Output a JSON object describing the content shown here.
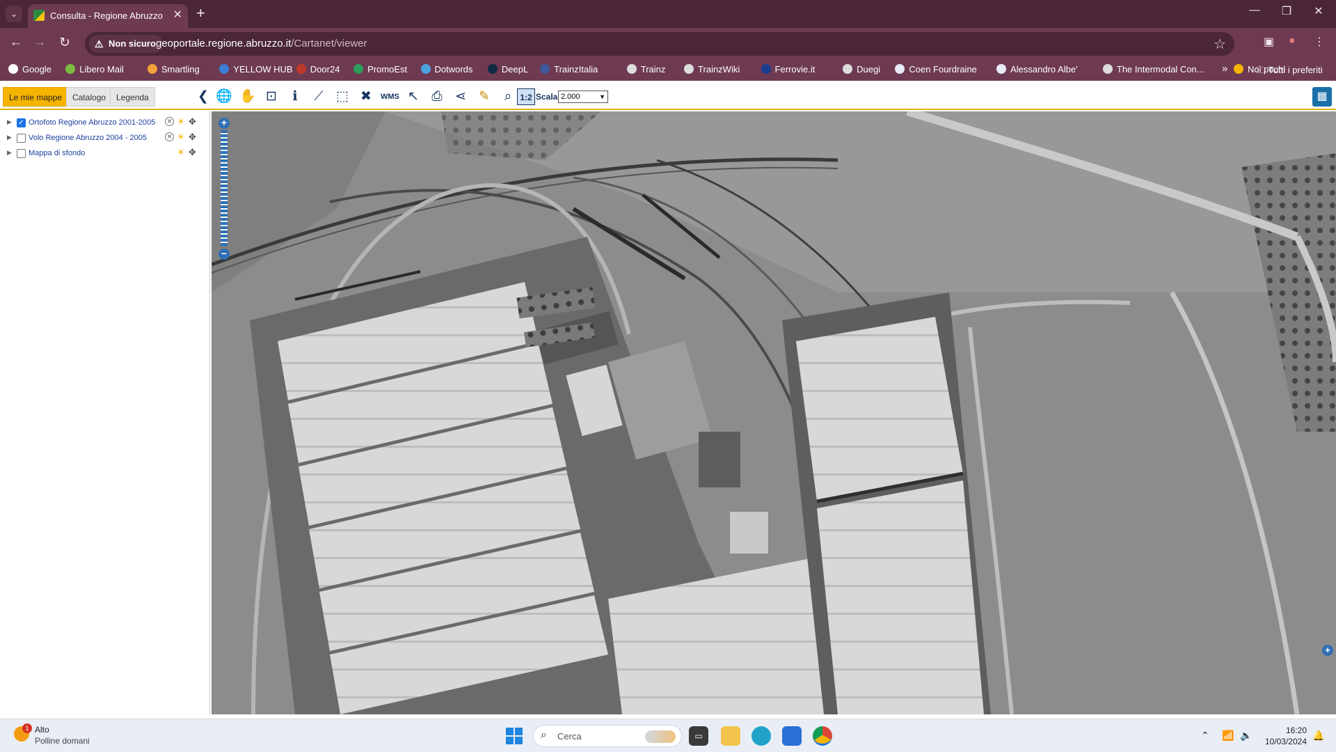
{
  "browser": {
    "tab_title": "Consulta - Regione Abruzzo",
    "not_secure_label": "Non sicuro",
    "url_host": "geoportale.regione.abruzzo.it",
    "url_path": "/Cartanet/viewer",
    "bookmarks": [
      {
        "label": "Google",
        "color": "#ffffff"
      },
      {
        "label": "Libero Mail",
        "color": "#7dbb42"
      },
      {
        "label": "Smartling",
        "color": "#f4a23c"
      },
      {
        "label": "YELLOW HUB",
        "color": "#3b7dd8"
      },
      {
        "label": "Door24",
        "color": "#c0392b"
      },
      {
        "label": "PromoEst",
        "color": "#2e9e5b"
      },
      {
        "label": "Dotwords",
        "color": "#4aa3df"
      },
      {
        "label": "DeepL",
        "color": "#0f2b46"
      },
      {
        "label": "TrainzItalia",
        "color": "#3b5998"
      },
      {
        "label": "Trainz",
        "color": "#dddddd"
      },
      {
        "label": "TrainzWiki",
        "color": "#dddddd"
      },
      {
        "label": "Ferrovie.it",
        "color": "#1a3f8f"
      },
      {
        "label": "Duegi",
        "color": "#dddddd"
      },
      {
        "label": "Coen Fourdraine",
        "color": "#e8eaf6"
      },
      {
        "label": "Alessandro Albe'",
        "color": "#e8eaf6"
      },
      {
        "label": "The Intermodal Con...",
        "color": "#dddddd"
      },
      {
        "label": "Noi pochi",
        "color": "#f4b400"
      }
    ],
    "all_bookmarks_label": "Tutti i preferiti"
  },
  "app": {
    "tabs": [
      {
        "label": "Le mie mappe",
        "active": true
      },
      {
        "label": "Catalogo",
        "active": false
      },
      {
        "label": "Legenda",
        "active": false
      }
    ],
    "tools": [
      "collapse-panel-icon",
      "globe-icon",
      "pan-hand-icon",
      "zoom-extent-icon",
      "info-icon",
      "measure-line-icon",
      "measure-area-icon",
      "clear-icon",
      "wms-layer-icon",
      "select-icon",
      "print-icon",
      "share-icon",
      "draw-icon",
      "zoom-icon",
      "scale-ratio-icon"
    ],
    "scale_label": "Scala:",
    "scale_value": "2.000",
    "layers": [
      {
        "name": "Ortofoto Regione Abruzzo 2001-2005",
        "checked": true,
        "removable": true
      },
      {
        "name": "Volo Regione Abruzzo 2004 - 2005",
        "checked": false,
        "removable": true
      },
      {
        "name": "Mappa di sfondo",
        "checked": false,
        "removable": false
      }
    ]
  },
  "taskbar": {
    "weather_title": "Alto",
    "weather_subtitle": "Polline domani",
    "weather_badge": "1",
    "search_placeholder": "Cerca",
    "time": "16:20",
    "date": "10/03/2024"
  }
}
